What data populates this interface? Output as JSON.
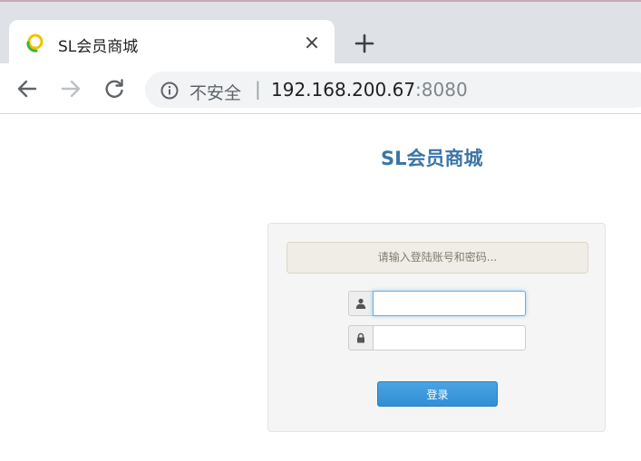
{
  "browser": {
    "tab": {
      "title": "SL会员商城",
      "favicon": "sl-logo-icon",
      "close_icon": "close-icon"
    },
    "new_tab_icon": "plus-icon",
    "nav": {
      "back_icon": "arrow-left-icon",
      "forward_icon": "arrow-right-icon",
      "reload_icon": "reload-icon"
    },
    "omnibox": {
      "info_icon": "info-icon",
      "security_label": "不安全",
      "separator": "|",
      "host": "192.168.200.67",
      "port": ":8080"
    }
  },
  "page": {
    "heading": "SL会员商城",
    "login": {
      "alert": "请输入登陆账号和密码...",
      "username": {
        "icon": "user-icon",
        "value": "",
        "placeholder": ""
      },
      "password": {
        "icon": "lock-icon",
        "value": "",
        "placeholder": ""
      },
      "submit_label": "登录"
    }
  },
  "colors": {
    "heading": "#3a75a8",
    "button": "#2f8fd6",
    "alert_bg": "#efede5",
    "panel_bg": "#f5f5f5",
    "focus_border": "#66afe9"
  }
}
